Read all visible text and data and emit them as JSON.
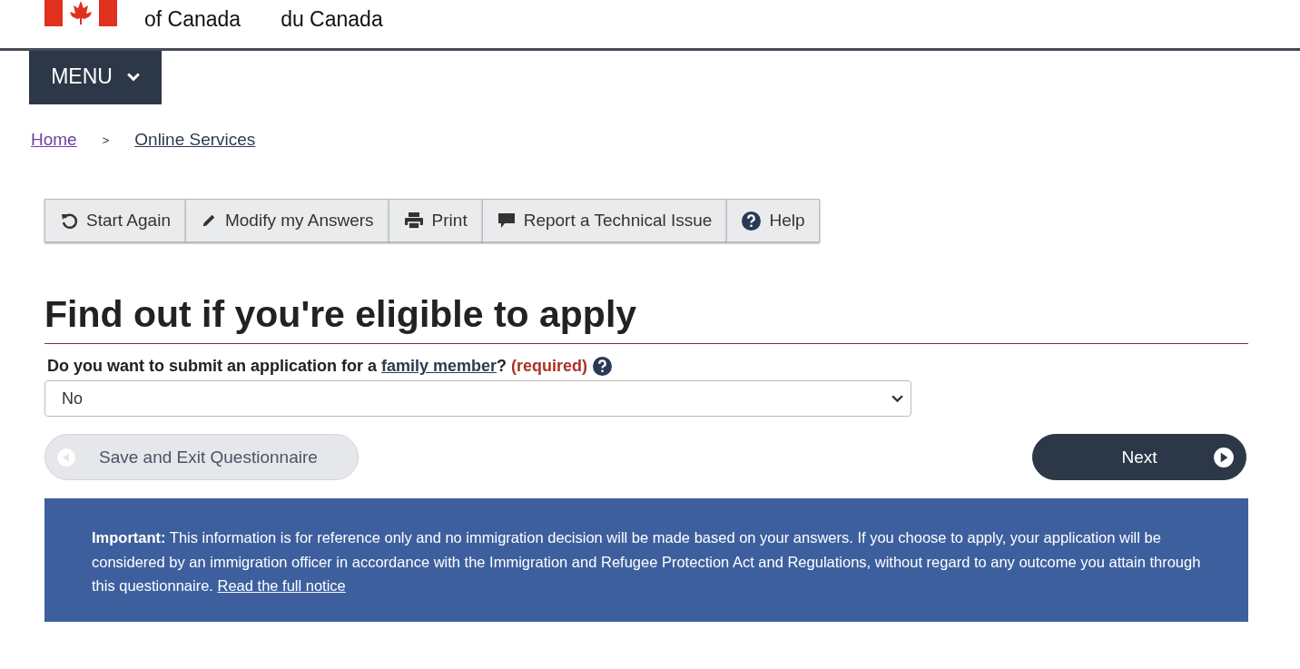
{
  "header": {
    "english_name": "of Canada",
    "french_name": "du Canada"
  },
  "menu": {
    "label": "MENU"
  },
  "breadcrumb": [
    {
      "label": "Home",
      "visited": true
    },
    {
      "label": "Online Services",
      "visited": false
    }
  ],
  "breadcrumb_separator": ">",
  "toolbar": [
    {
      "label": "Start Again"
    },
    {
      "label": "Modify my Answers"
    },
    {
      "label": "Print"
    },
    {
      "label": "Report a Technical Issue"
    },
    {
      "label": "Help"
    }
  ],
  "heading": "Find out if you're eligible to apply",
  "question": {
    "before": "Do you want to submit an application for a ",
    "link": "family member",
    "after": "?",
    "required": "(required)"
  },
  "select": {
    "value": "No"
  },
  "buttons": {
    "back": {
      "label": "Save and Exit Questionnaire",
      "disabled": true
    },
    "next": {
      "label": "Next",
      "disabled": false
    }
  },
  "notice": {
    "text": "**Important:** This information is for reference only and no immigration decision will be made based on your answers. If you choose to apply, your application will be considered by an immigration officer in accordance with the Immigration and Refugee Protection Act and Regulations, without regard to any outcome you attain through this questionnaire.",
    "link": "Read the full notice"
  }
}
